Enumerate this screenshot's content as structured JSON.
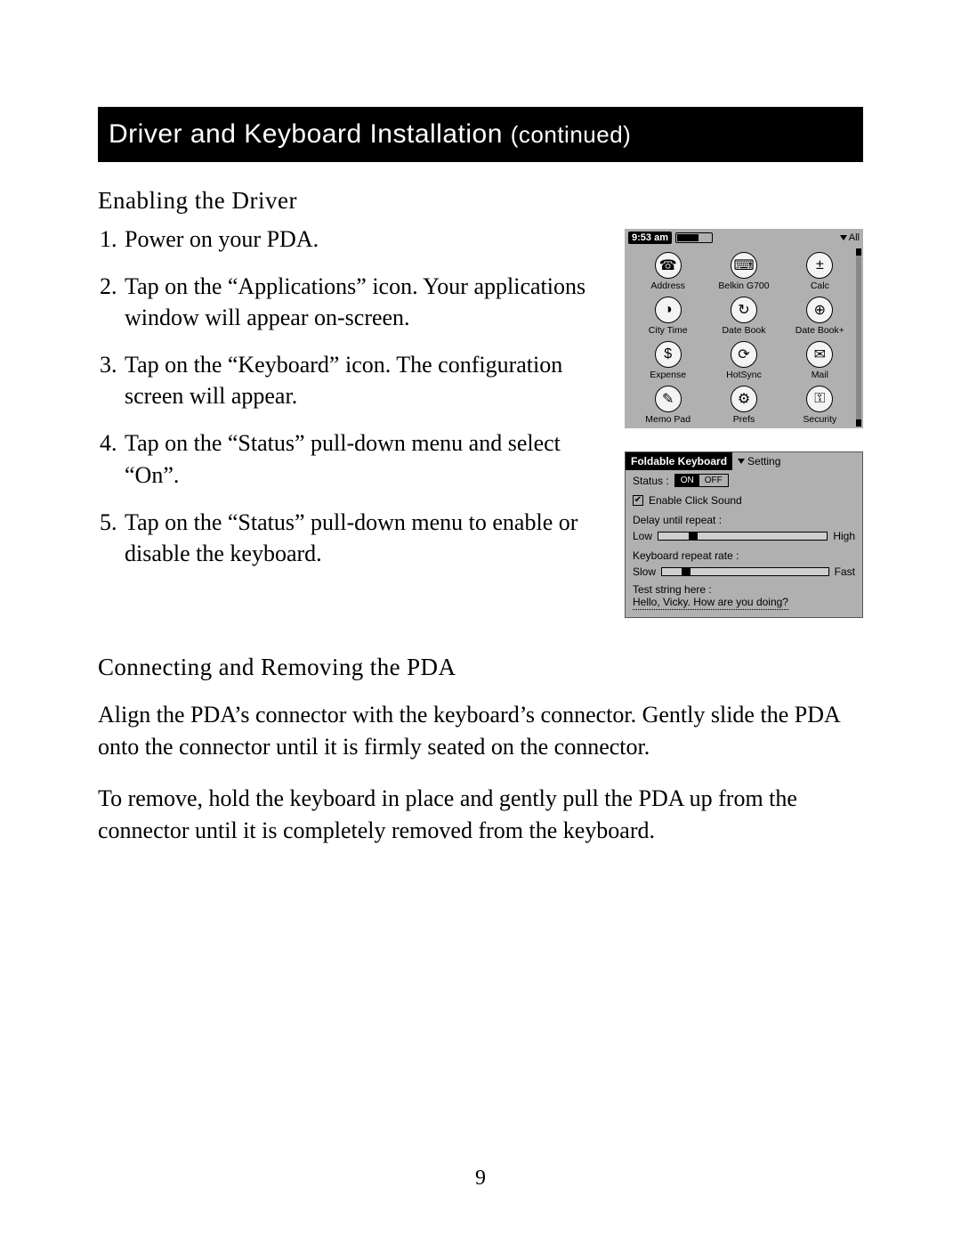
{
  "header": {
    "title": "Driver and Keyboard Installation ",
    "continued": "(continued)"
  },
  "section1": {
    "heading": "Enabling the Driver",
    "steps": [
      "Power on your PDA.",
      "Tap on the “Applications” icon. Your applications window will appear on-screen.",
      "Tap on the “Keyboard” icon. The configuration screen will appear.",
      "Tap on the “Status” pull-down menu and select “On”.",
      "Tap on the “Status” pull-down menu to enable or disable the keyboard."
    ]
  },
  "pda": {
    "time": "9:53 am",
    "category": "All",
    "apps": [
      {
        "label": "Address",
        "glyph": "☎"
      },
      {
        "label": "Belkin G700",
        "glyph": "⌨"
      },
      {
        "label": "Calc",
        "glyph": "±"
      },
      {
        "label": "City Time",
        "glyph": "◑"
      },
      {
        "label": "Date Book",
        "glyph": "↻"
      },
      {
        "label": "Date Book+",
        "glyph": "⊕"
      },
      {
        "label": "Expense",
        "glyph": "$"
      },
      {
        "label": "HotSync",
        "glyph": "⟳"
      },
      {
        "label": "Mail",
        "glyph": "✉"
      },
      {
        "label": "Memo Pad",
        "glyph": "✎"
      },
      {
        "label": "Prefs",
        "glyph": "⚙"
      },
      {
        "label": "Security",
        "glyph": "⚿"
      }
    ]
  },
  "settings": {
    "title": "Foldable Keyboard",
    "dropdown": "Setting",
    "status_label": "Status :",
    "on": "ON",
    "off": "OFF",
    "click_sound": "Enable Click Sound",
    "delay_label": "Delay until repeat :",
    "low": "Low",
    "high": "High",
    "rate_label": "Keyboard repeat rate :",
    "slow": "Slow",
    "fast": "Fast",
    "test_label": "Test string here :",
    "test_value": "Hello, Vicky. How are you doing?"
  },
  "section2": {
    "heading": "Connecting and Removing the PDA",
    "p1": "Align the PDA’s connector with the keyboard’s connector. Gently slide the PDA onto the connector until it is firmly seated on the connector.",
    "p2": "To remove, hold the keyboard in place and gently pull the PDA up from the connector until it is completely removed from the keyboard."
  },
  "page_number": "9"
}
